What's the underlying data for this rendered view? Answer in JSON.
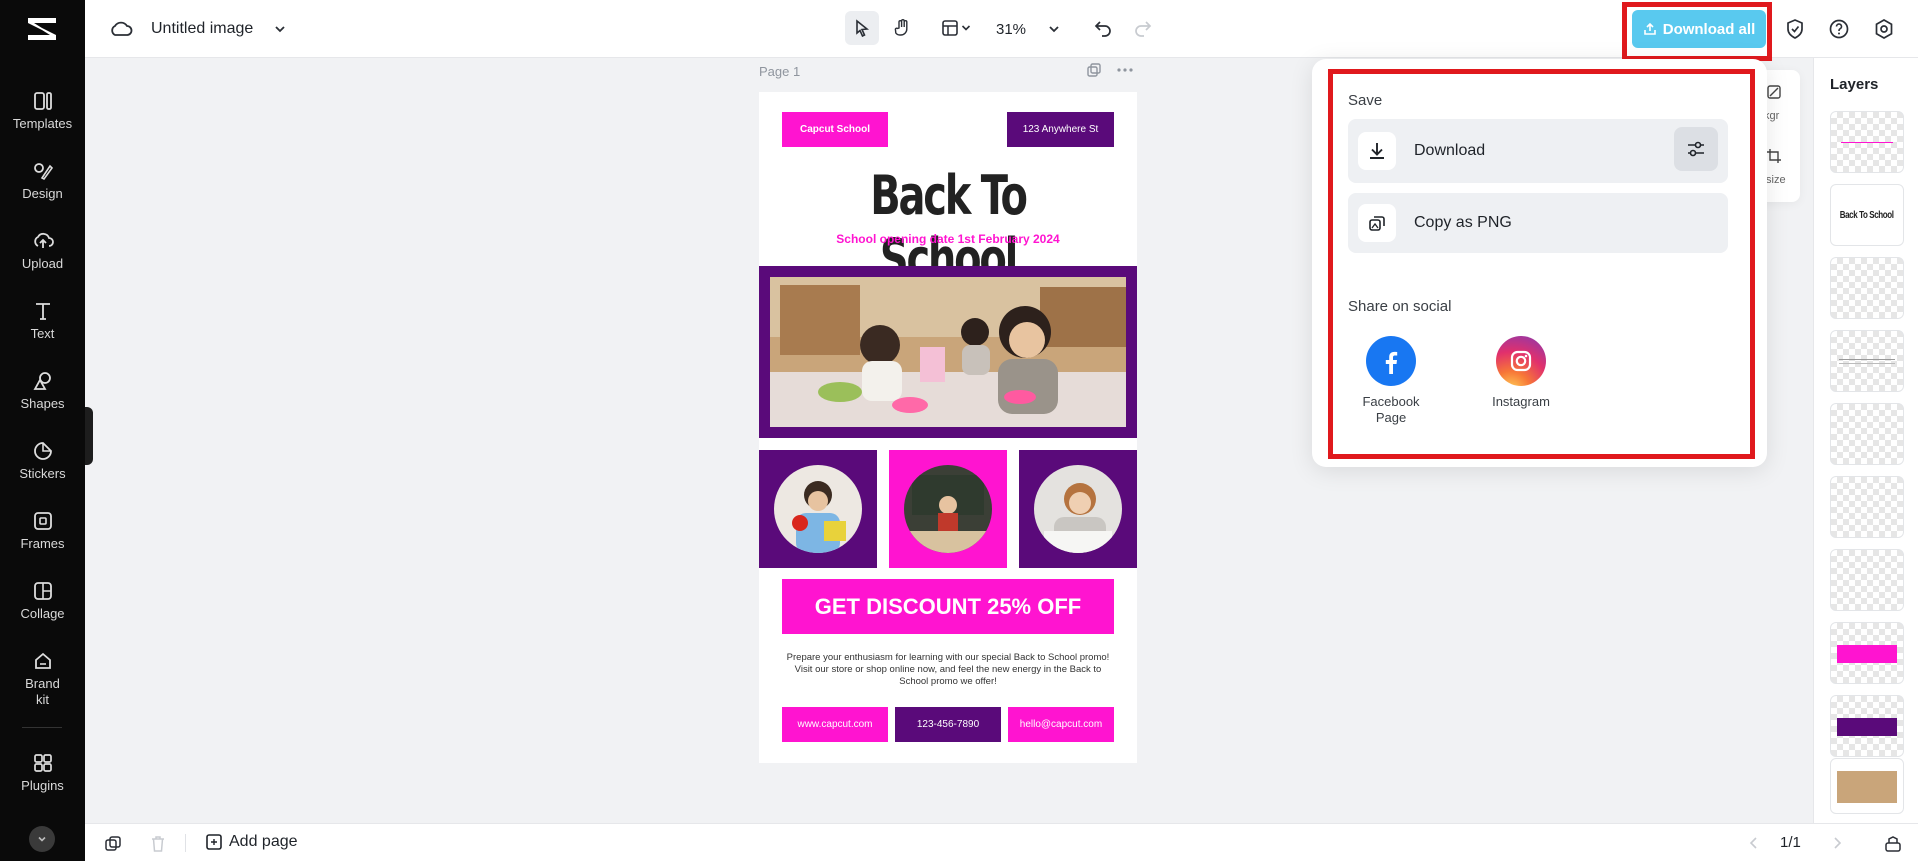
{
  "rail": {
    "items": [
      {
        "label": "Templates",
        "icon": "templates-icon"
      },
      {
        "label": "Design",
        "icon": "design-icon"
      },
      {
        "label": "Upload",
        "icon": "upload-icon"
      },
      {
        "label": "Text",
        "icon": "text-icon"
      },
      {
        "label": "Shapes",
        "icon": "shapes-icon"
      },
      {
        "label": "Stickers",
        "icon": "stickers-icon"
      },
      {
        "label": "Frames",
        "icon": "frames-icon"
      },
      {
        "label": "Collage",
        "icon": "collage-icon"
      },
      {
        "label": "Brand kit",
        "icon": "brand-kit-icon"
      },
      {
        "label": "Plugins",
        "icon": "plugins-icon"
      }
    ]
  },
  "topbar": {
    "title": "Untitled image",
    "zoom": "31%",
    "download_all": "Download all"
  },
  "canvas": {
    "page_label": "Page 1",
    "poster": {
      "school": "Capcut School",
      "address": "123 Anywhere St",
      "headline": "Back To School",
      "subline": "School opening date 1st February 2024",
      "discount": "GET DISCOUNT 25% OFF",
      "body": "Prepare your enthusiasm for learning with our special Back to School promo! Visit our store or shop online now, and feel the new energy in the Back to School promo we offer!",
      "website": "www.capcut.com",
      "phone": "123-456-7890",
      "email": "hello@capcut.com"
    }
  },
  "popup": {
    "save_title": "Save",
    "download_label": "Download",
    "copy_label": "Copy as PNG",
    "share_title": "Share on social",
    "social": [
      {
        "label": "Facebook Page",
        "color": "#1877f2"
      },
      {
        "label": "Instagram",
        "color": "#e1306c"
      }
    ]
  },
  "fragment": {
    "top": "kgr",
    "bottom": "size"
  },
  "layers": {
    "title": "Layers",
    "headline_thumb": "Back To School"
  },
  "bottombar": {
    "add_page": "Add page",
    "pager": "1/1"
  },
  "colors": {
    "accent": "#59c9ef",
    "pink": "#ff14d0",
    "purple": "#5a0a7a",
    "highlight": "#e0191d"
  }
}
